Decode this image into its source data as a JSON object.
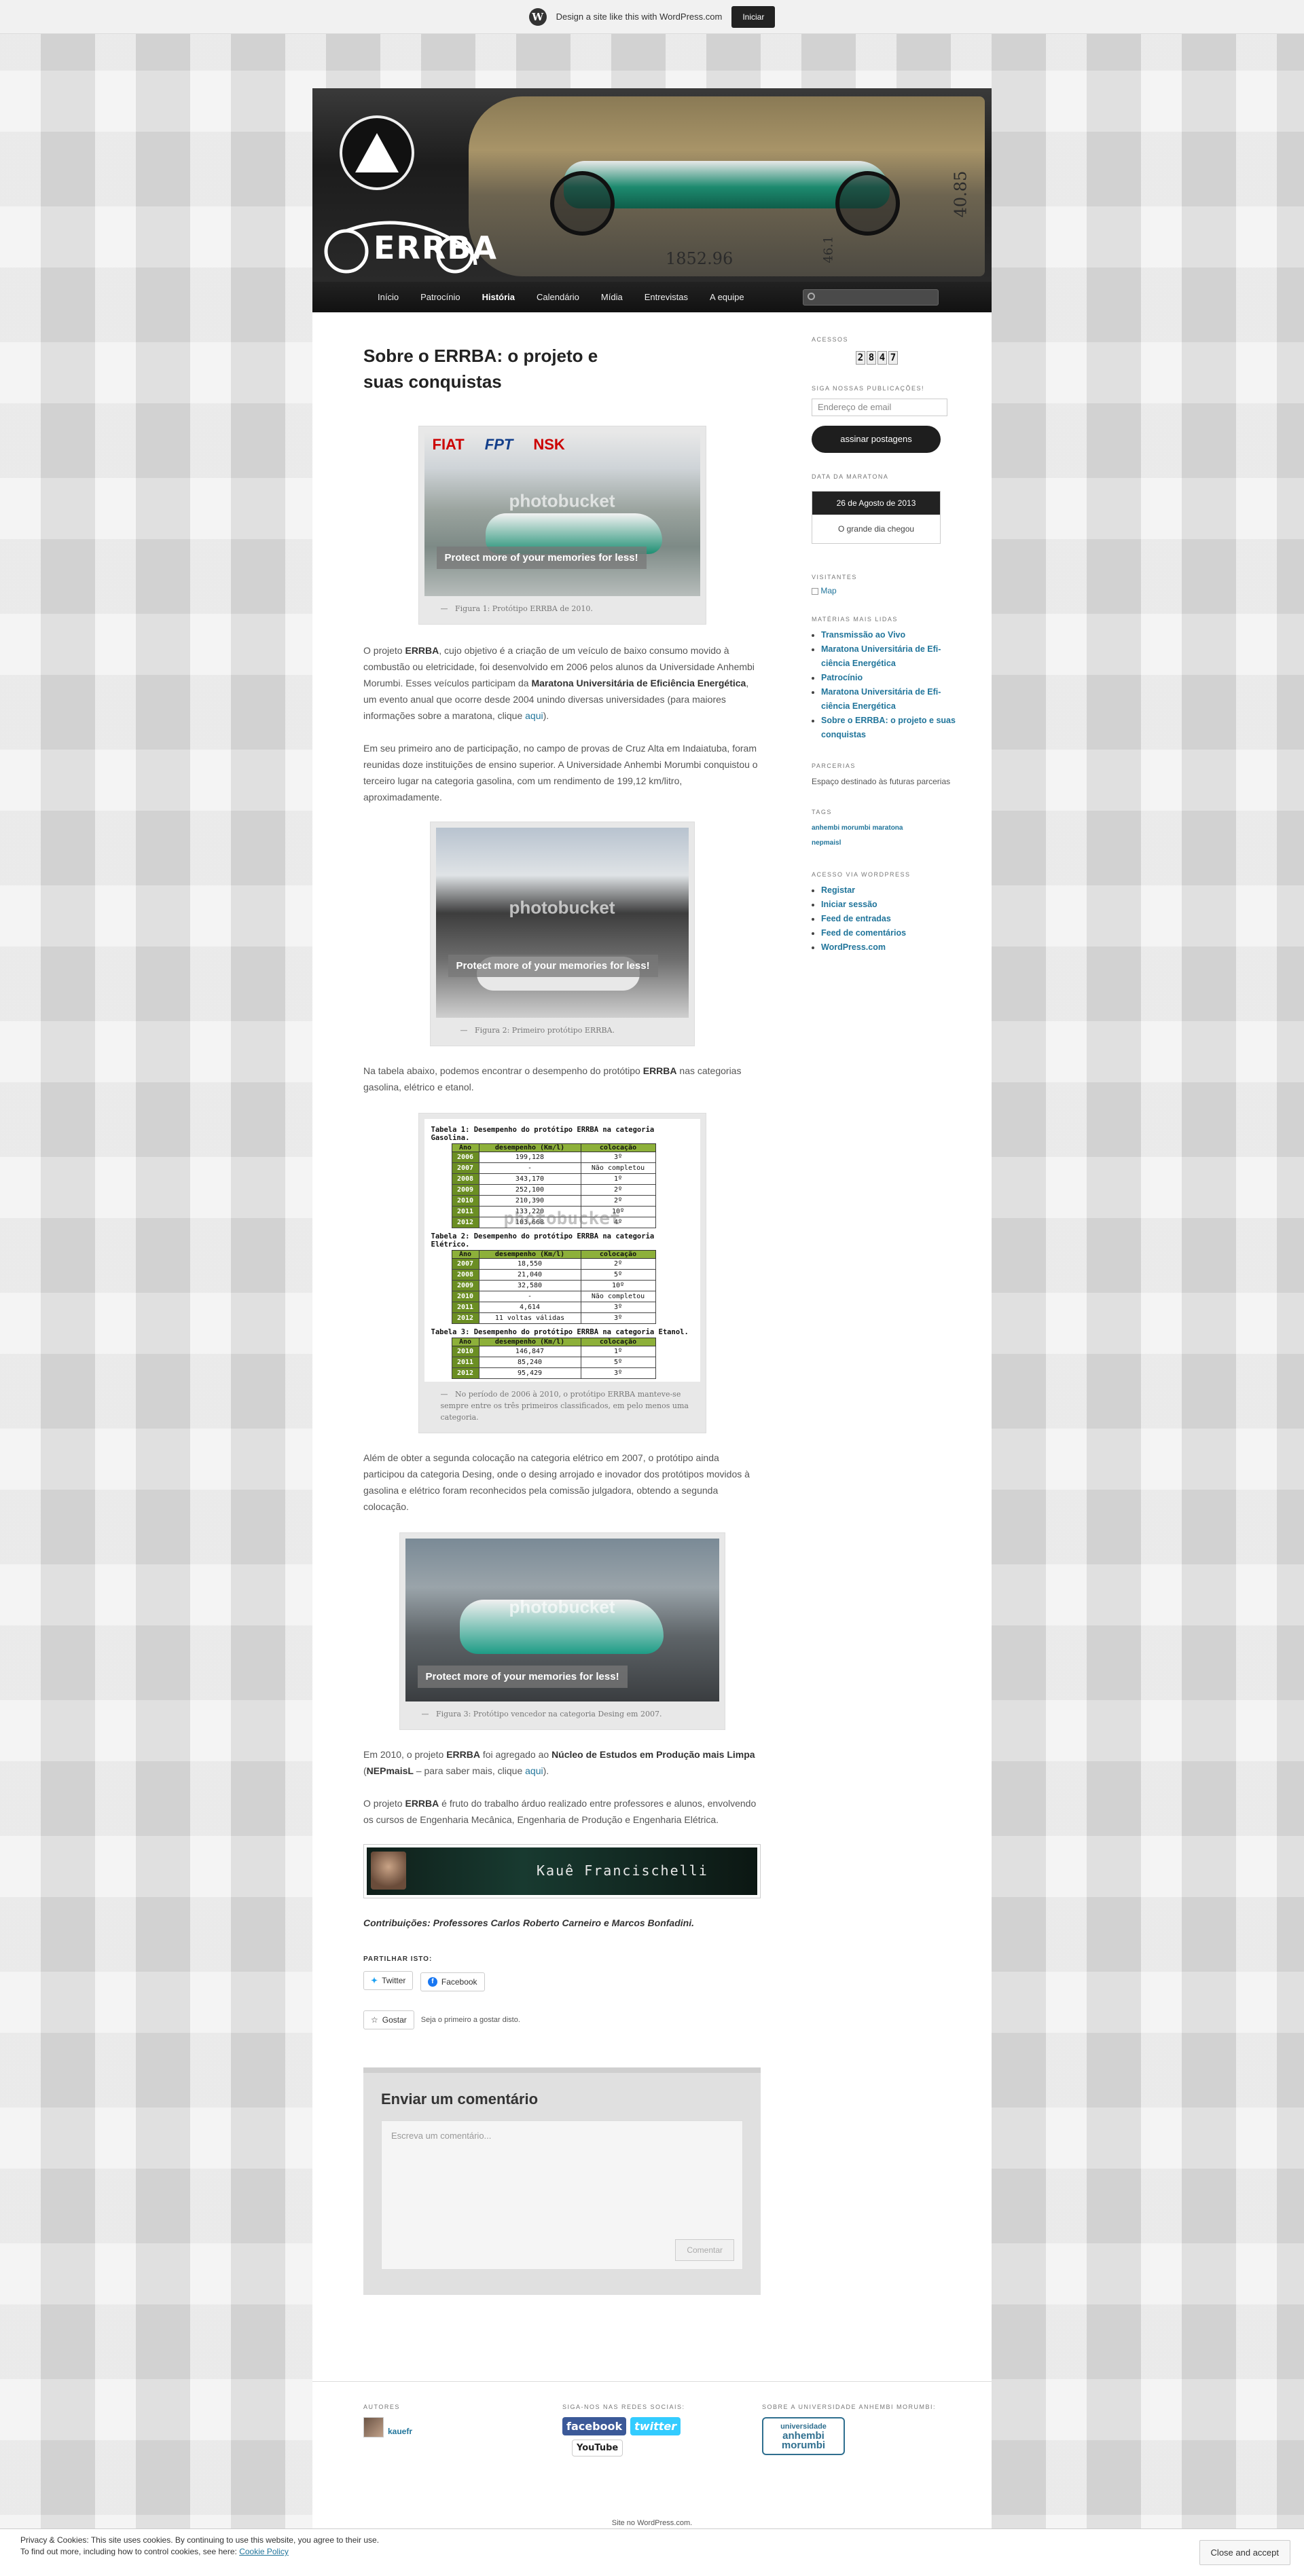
{
  "wpbar": {
    "text": "Design a site like this with WordPress.com",
    "button": "Iniciar"
  },
  "header": {
    "logo_text": "ERRBA",
    "logo_ring": "UNIVERSIDADE ANHEMBI MORUMBI",
    "dim1": "1852.96",
    "dim2": "40.85",
    "dim3": "46.1"
  },
  "nav": {
    "items": [
      "Início",
      "Patrocínio",
      "História",
      "Calendário",
      "Mídia",
      "Entrevistas",
      "A equipe"
    ],
    "active_index": 2
  },
  "post": {
    "title": "Sobre o ERRBA: o projeto e suas conquistas",
    "watermark": "photobucket",
    "protect": "Protect more of your memories for less!",
    "fig1_caption": "Figura 1: Protótipo ERRBA de 2010.",
    "fig1_sponsors": [
      "FIAT",
      "FPT",
      "NSK"
    ],
    "p1_a": "O projeto ",
    "p1_b": "ERRBA",
    "p1_c": ", cujo objetivo é a criação de um veículo de baixo consumo movido à combustão ou eletricidade, foi desenvolvido em 2006 pelos alunos da Universidade Anhembi Morumbi. Esses veículos participam da ",
    "p1_d": "Maratona Universitária de Eficiência Energética",
    "p1_e": ", um evento anual que ocorre desde 2004 unindo diversas universidades (para maiores informações sobre a maratona, clique ",
    "p1_link": "aqui",
    "p1_f": ").",
    "p2": "Em seu primeiro ano de participação, no campo de provas de Cruz Alta em Indaiatuba, foram reunidas doze instituições de ensino superior. A Universidade Anhembi Morumbi conquistou o terceiro lugar na categoria gasolina, com um rendimento de 199,12 km/litro, aproximadamente.",
    "fig2_caption": "Figura 2: Primeiro protótipo ERRBA.",
    "p3_a": "Na tabela abaixo, podemos encontrar o desempenho do protótipo ",
    "p3_b": "ERRBA",
    "p3_c": " nas categorias gasolina, elétrico e etanol.",
    "tables_caption": "No período de 2006 à 2010, o protótipo ERRBA manteve-se sempre entre os três primeiros classificados, em pelo menos uma categoria.",
    "p4": "Além de obter a segunda colocação na categoria elétrico em 2007, o protótipo ainda participou da categoria Desing, onde o desing arrojado e inovador dos protótipos movidos à gasolina e elétrico foram reconhecidos pela comissão julgadora, obtendo a segunda colocação.",
    "fig3_caption": "Figura 3: Protótipo vencedor na categoria Desing em 2007.",
    "p5_a": "Em 2010, o projeto ",
    "p5_b": "ERRBA",
    "p5_c": " foi agregado ao ",
    "p5_d": "Núcleo de Estudos em Produção mais Limpa",
    "p5_e": " (",
    "p5_f": "NEPmaisL",
    "p5_g": " – para saber mais, clique ",
    "p5_link": "aqui",
    "p5_h": ").",
    "p6_a": "O projeto ",
    "p6_b": "ERRBA",
    "p6_c": " é fruto do trabalho árduo realizado entre professores e alunos, envolvendo os cursos de Engenharia Mecânica, Engenharia de Produção e Engenharia Elétrica.",
    "signature_name": "Kauê Francischelli",
    "contrib": "Contribuições: Professores Carlos Roberto Carneiro e Marcos Bonfadini.",
    "share_heading": "PARTILHAR ISTO:",
    "share_twitter": "Twitter",
    "share_facebook": "Facebook",
    "like_button": "Gostar",
    "like_text": "Seja o primeiro a gostar disto.",
    "comment_title": "Enviar um comentário",
    "comment_placeholder": "Escreva um comentário...",
    "comment_submit": "Comentar"
  },
  "tables": [
    {
      "title": "Tabela 1: Desempenho do protótipo ERRBA na categoria Gasolina.",
      "headers": [
        "Ano",
        "desempenho (Km/l)",
        "colocação"
      ],
      "rows": [
        [
          "2006",
          "199,128",
          "3º"
        ],
        [
          "2007",
          "-",
          "Não completou"
        ],
        [
          "2008",
          "343,170",
          "1º"
        ],
        [
          "2009",
          "252,100",
          "2º"
        ],
        [
          "2010",
          "210,390",
          "2º"
        ],
        [
          "2011",
          "133,220",
          "10º"
        ],
        [
          "2012",
          "103,668",
          "4º"
        ]
      ]
    },
    {
      "title": "Tabela 2: Desempenho do protótipo ERRBA na categoria Elétrico.",
      "headers": [
        "Ano",
        "desempenho (Km/l)",
        "colocação"
      ],
      "rows": [
        [
          "2007",
          "18,550",
          "2º"
        ],
        [
          "2008",
          "21,040",
          "5º"
        ],
        [
          "2009",
          "32,580",
          "10º"
        ],
        [
          "2010",
          "-",
          "Não completou"
        ],
        [
          "2011",
          "4,614",
          "3º"
        ],
        [
          "2012",
          "11 voltas válidas",
          "3º"
        ]
      ]
    },
    {
      "title": "Tabela 3: Desempenho do protótipo ERRBA na categoria Etanol.",
      "headers": [
        "Ano",
        "desempenho (Km/l)",
        "colocação"
      ],
      "rows": [
        [
          "2010",
          "146,847",
          "1º"
        ],
        [
          "2011",
          "85,240",
          "5º"
        ],
        [
          "2012",
          "95,429",
          "3º"
        ]
      ]
    }
  ],
  "sidebar": {
    "acessos_title": "ACESSOS",
    "counter_digits": [
      "2",
      "8",
      "4",
      "7"
    ],
    "follow_title": "SIGA NOSSAS PUBLICAÇÕES!",
    "email_placeholder": "Endereço de email",
    "subscribe_label": "assinar postagens",
    "marathon_title": "DATA DA MARATONA",
    "marathon_date": "26 de Agosto de 2013",
    "marathon_note": "O grande dia chegou",
    "visitors_title": "VISITANTES",
    "visitors_map": "Map",
    "popular_title": "MATÉRIAS MAIS LIDAS",
    "popular_items": [
      "Transmissão ao Vivo",
      "Maratona Universitária de Efi-ciência Energética",
      "Patrocínio",
      "Maratona Universitária de Efi-ciência Energética",
      "Sobre o ERRBA: o projeto e suas conquistas"
    ],
    "partners_title": "PARCERIAS",
    "partners_text": "Espaço destinado às futuras parcerias",
    "tags_title": "TAGS",
    "tags": [
      "anhembi morumbi maratona",
      "nepmaisl"
    ],
    "access_title": "ACESSO VIA WORDPRESS",
    "access_items": [
      "Registar",
      "Iniciar sessão",
      "Feed de entradas",
      "Feed de comentários",
      "WordPress.com"
    ]
  },
  "footer": {
    "authors_title": "AUTORES",
    "author_name": "kauefr",
    "social_title": "SIGA-NOS NAS REDES SOCIAIS:",
    "social": [
      "facebook",
      "twitter",
      "YouTube"
    ],
    "about_title": "SOBRE A UNIVERSIDADE ANHEMBI MORUMBI:",
    "uni_logo_line1": "universidade",
    "uni_logo_line2": "anhembi",
    "uni_logo_line3": "morumbi",
    "site_by": "Site no WordPress.com."
  },
  "cookie": {
    "line1": "Privacy & Cookies: This site uses cookies. By continuing to use this website, you agree to their use.",
    "line2": "To find out more, including how to control cookies, see here: ",
    "link": "Cookie Policy",
    "button": "Close and accept"
  },
  "colors": {
    "link": "#21759b",
    "nav_bg": "#111111",
    "table_green": "#6b8e23",
    "facebook": "#3b5998",
    "twitter": "#33ccff",
    "youtube": "#cc0000"
  }
}
